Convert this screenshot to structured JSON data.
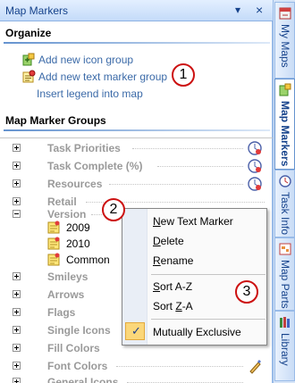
{
  "panel": {
    "title": "Map Markers",
    "pin_glyph": "▾",
    "close_glyph": "×"
  },
  "organize": {
    "header": "Organize",
    "links": [
      {
        "label": "Add new icon group",
        "icon": "add-icon-group-icon"
      },
      {
        "label": "Add new text marker group",
        "icon": "add-text-marker-group-icon"
      },
      {
        "label": "Insert legend into map",
        "icon": ""
      }
    ]
  },
  "groups": {
    "header": "Map Marker Groups",
    "rows": [
      {
        "label": "Task Priorities",
        "expander": "plus"
      },
      {
        "label": "Task Complete (%)",
        "expander": "plus"
      },
      {
        "label": "Resources",
        "expander": "plus"
      },
      {
        "label": "Retail",
        "expander": "plus"
      },
      {
        "label": "Version",
        "expander": "minus"
      },
      {
        "label": "Smileys",
        "expander": "plus"
      },
      {
        "label": "Arrows",
        "expander": "plus"
      },
      {
        "label": "Flags",
        "expander": "plus"
      },
      {
        "label": "Single Icons",
        "expander": "plus"
      },
      {
        "label": "Fill Colors",
        "expander": "plus"
      },
      {
        "label": "Font Colors",
        "expander": "plus"
      },
      {
        "label": "General Icons",
        "expander": "plus"
      }
    ],
    "version_children": [
      "2009",
      "2010",
      "Common"
    ]
  },
  "context_menu": {
    "items": [
      {
        "label": "New Text Marker",
        "mnemonic": "N",
        "rest": "ew Text Marker"
      },
      {
        "label": "Delete",
        "mnemonic": "D",
        "rest": "elete"
      },
      {
        "label": "Rename",
        "mnemonic": "R",
        "rest": "ename"
      },
      {
        "label": "Sort A-Z",
        "mnemonic": "S",
        "rest": "ort A-Z"
      },
      {
        "label": "Sort Z-A",
        "pre": "Sort ",
        "mnemonic": "Z",
        "rest": "-A"
      },
      {
        "label": "Mutually Exclusive",
        "mnemonic": "",
        "rest": "Mutually Exclusive"
      }
    ],
    "checked_item": "Mutually Exclusive",
    "check_glyph": "✓"
  },
  "callouts": [
    "1",
    "2",
    "3"
  ],
  "side_tabs": [
    {
      "label": "My Maps",
      "icon": "my-maps-icon"
    },
    {
      "label": "Map Markers",
      "icon": "map-markers-icon",
      "active": true
    },
    {
      "label": "Task Info",
      "icon": "task-info-icon"
    },
    {
      "label": "Map Parts",
      "icon": "map-parts-icon"
    },
    {
      "label": "Library",
      "icon": "library-icon"
    }
  ],
  "colors": {
    "accent": "#15428b",
    "link": "#3b6aa8",
    "callout_border": "#cc1111",
    "check_highlight": "#fbd77a"
  }
}
